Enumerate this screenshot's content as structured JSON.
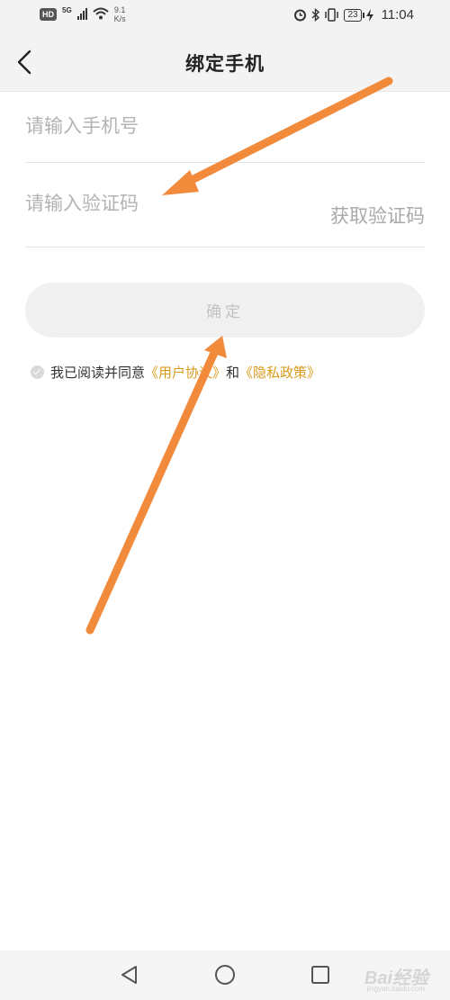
{
  "status_bar": {
    "network_hd": "HD",
    "network_gen": "5G",
    "speed_value": "9.1",
    "speed_unit": "K/s",
    "battery": "23",
    "time": "11:04"
  },
  "header": {
    "title": "绑定手机"
  },
  "form": {
    "phone_placeholder": "请输入手机号",
    "code_placeholder": "请输入验证码",
    "get_code_label": "获取验证码",
    "confirm_label": "确定"
  },
  "agreement": {
    "text": "我已阅读并同意",
    "user_agreement": "《用户协议》",
    "and": "和",
    "privacy_policy": "《隐私政策》"
  },
  "watermark": {
    "logo": "Bai经验",
    "url": "jingyan.baidu.com"
  },
  "colors": {
    "link": "#d79a1d",
    "annotation_arrow": "#f28a3c"
  }
}
